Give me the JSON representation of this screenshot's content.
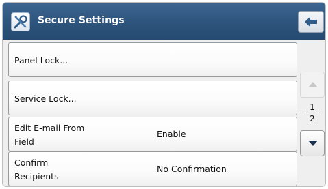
{
  "header": {
    "title": "Secure Settings",
    "app_icon": "tools-icon",
    "back_icon": "back-arrow-icon"
  },
  "rows": [
    {
      "label_lines": [
        "Panel Lock..."
      ],
      "value": ""
    },
    {
      "label_lines": [
        "Service Lock..."
      ],
      "value": ""
    },
    {
      "label_lines": [
        "Edit E-mail From",
        "Field"
      ],
      "value": "Enable"
    },
    {
      "label_lines": [
        "Confirm",
        "Recipients"
      ],
      "value": "No Confirmation"
    }
  ],
  "pager": {
    "current": "1",
    "total": "2",
    "up_icon": "scroll-up-icon",
    "down_icon": "scroll-down-icon",
    "up_enabled": false
  },
  "colors": {
    "title_bar": "#2d547c",
    "background": "#efefef"
  }
}
